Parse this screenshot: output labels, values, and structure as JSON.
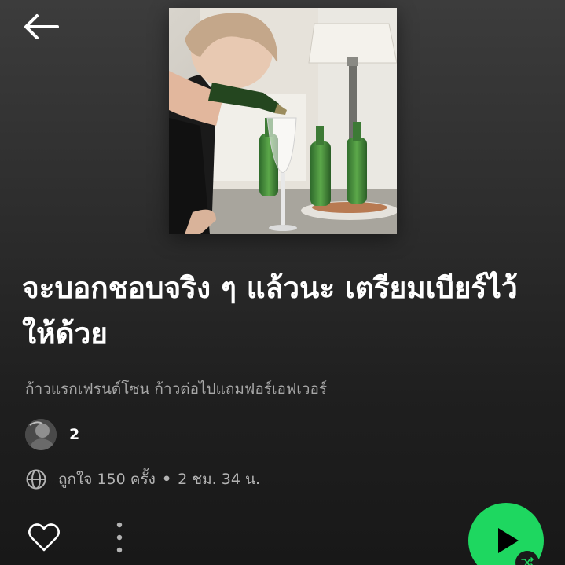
{
  "header": {
    "back_icon": "arrow-left-icon"
  },
  "playlist": {
    "title": "จะบอกชอบจริง ๆ แล้วนะ เตรียมเบียร์ไว้ให้ด้วย",
    "description": "ก้าวแรกเฟรนด์โซน ก้าวต่อไปแถมฟอร์เอฟเวอร์",
    "owner_name": "2",
    "likes_text": "ถูกใจ 150 ครั้ง",
    "separator": "•",
    "duration_text": "2 ชม. 34 น."
  },
  "icons": {
    "visibility": "globe-icon",
    "like": "heart-outline-icon",
    "more": "more-vertical-icon",
    "play": "play-icon",
    "shuffle": "shuffle-icon"
  },
  "colors": {
    "accent": "#1ed760",
    "text_primary": "#ffffff",
    "text_secondary": "#a7a7a7"
  }
}
